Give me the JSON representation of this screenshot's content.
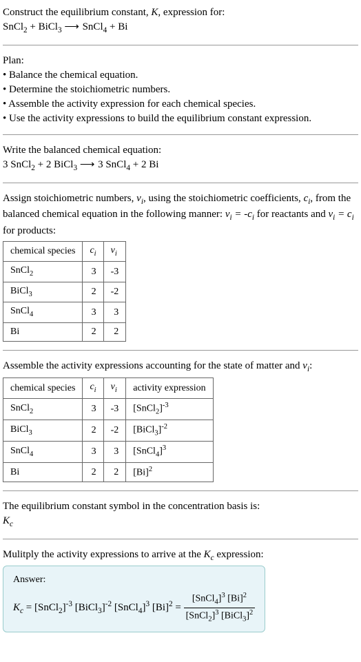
{
  "intro": {
    "line1": "Construct the equilibrium constant, ",
    "k": "K",
    "line1b": ", expression for:",
    "equation": "SnCl₂ + BiCl₃ ⟶ SnCl₄ + Bi"
  },
  "plan": {
    "title": "Plan:",
    "items": [
      "• Balance the chemical equation.",
      "• Determine the stoichiometric numbers.",
      "• Assemble the activity expression for each chemical species.",
      "• Use the activity expressions to build the equilibrium constant expression."
    ]
  },
  "balanced": {
    "title": "Write the balanced chemical equation:",
    "equation": "3 SnCl₂ + 2 BiCl₃ ⟶ 3 SnCl₄ + 2 Bi"
  },
  "assign": {
    "text1": "Assign stoichiometric numbers, ",
    "nu": "νᵢ",
    "text2": ", using the stoichiometric coefficients, ",
    "ci": "cᵢ",
    "text3": ", from the balanced chemical equation in the following manner: ",
    "rule1": "νᵢ = -cᵢ",
    "text4": " for reactants and ",
    "rule2": "νᵢ = cᵢ",
    "text5": " for products:",
    "headers": [
      "chemical species",
      "cᵢ",
      "νᵢ"
    ],
    "rows": [
      {
        "species": "SnCl₂",
        "c": "3",
        "nu": "-3"
      },
      {
        "species": "BiCl₃",
        "c": "2",
        "nu": "-2"
      },
      {
        "species": "SnCl₄",
        "c": "3",
        "nu": "3"
      },
      {
        "species": "Bi",
        "c": "2",
        "nu": "2"
      }
    ]
  },
  "activity": {
    "title_a": "Assemble the activity expressions accounting for the state of matter and ",
    "nu": "νᵢ",
    "title_b": ":",
    "headers": [
      "chemical species",
      "cᵢ",
      "νᵢ",
      "activity expression"
    ],
    "rows": [
      {
        "species": "SnCl₂",
        "c": "3",
        "nu": "-3",
        "act": "[SnCl₂]⁻³"
      },
      {
        "species": "BiCl₃",
        "c": "2",
        "nu": "-2",
        "act": "[BiCl₃]⁻²"
      },
      {
        "species": "SnCl₄",
        "c": "3",
        "nu": "3",
        "act": "[SnCl₄]³"
      },
      {
        "species": "Bi",
        "c": "2",
        "nu": "2",
        "act": "[Bi]²"
      }
    ]
  },
  "symbol": {
    "title": "The equilibrium constant symbol in the concentration basis is:",
    "kc": "K꜀"
  },
  "multiply": {
    "title_a": "Mulitply the activity expressions to arrive at the ",
    "kc": "K꜀",
    "title_b": " expression:"
  },
  "answer": {
    "label": "Answer:",
    "lhs": "K꜀ = [SnCl₂]⁻³ [BiCl₃]⁻² [SnCl₄]³ [Bi]² = ",
    "frac_top": "[SnCl₄]³ [Bi]²",
    "frac_bot": "[SnCl₂]³ [BiCl₃]²"
  }
}
